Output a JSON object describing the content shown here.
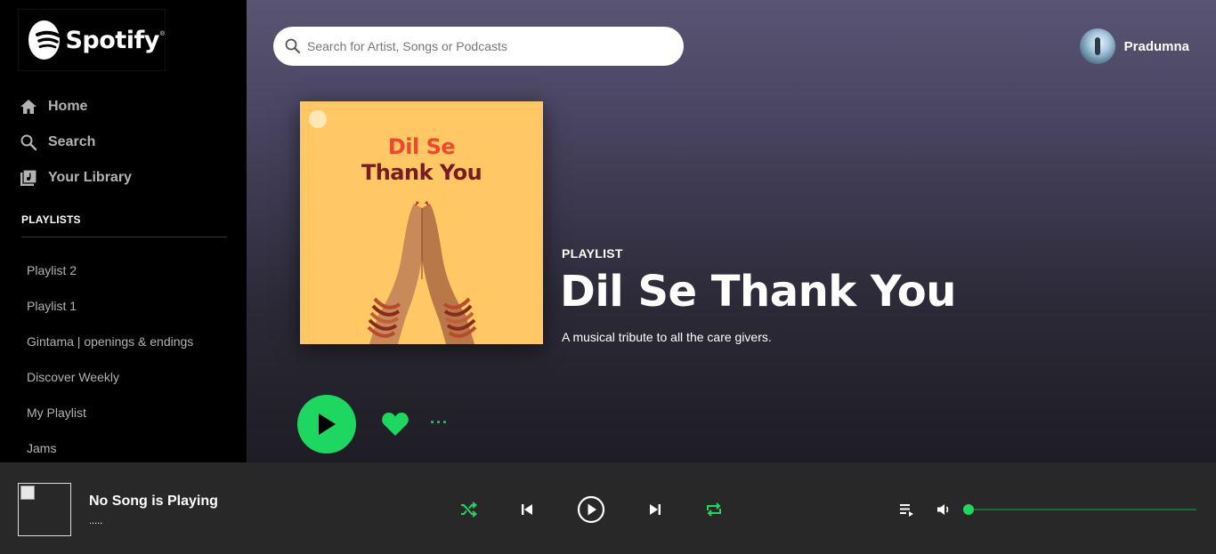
{
  "brand": {
    "name": "Spotify",
    "trademark": "®"
  },
  "nav": {
    "items": [
      {
        "label": "Home",
        "icon": "home-icon"
      },
      {
        "label": "Search",
        "icon": "search-icon"
      },
      {
        "label": "Your Library",
        "icon": "library-icon"
      }
    ]
  },
  "sidebar": {
    "playlists_title": "PLAYLISTS",
    "playlists": [
      "Playlist 2",
      "Playlist 1",
      "Gintama | openings & endings",
      "Discover Weekly",
      "My Playlist",
      "Jams"
    ]
  },
  "search": {
    "placeholder": "Search for Artist, Songs or Podcasts",
    "value": ""
  },
  "user": {
    "name": "Pradumna"
  },
  "playlist": {
    "type": "PLAYLIST",
    "title": "Dil Se Thank You",
    "description": "A musical tribute to all the care givers.",
    "cover_line1": "Dil Se",
    "cover_line2": "Thank You"
  },
  "actions": {
    "more": "···"
  },
  "now_playing": {
    "title": "No Song is Playing",
    "subtitle": "....."
  },
  "colors": {
    "accent": "#1ed760",
    "sidebar_bg": "#000000",
    "player_bg": "#282828",
    "cover_bg": "#ffc864"
  },
  "volume": {
    "level": 0
  }
}
